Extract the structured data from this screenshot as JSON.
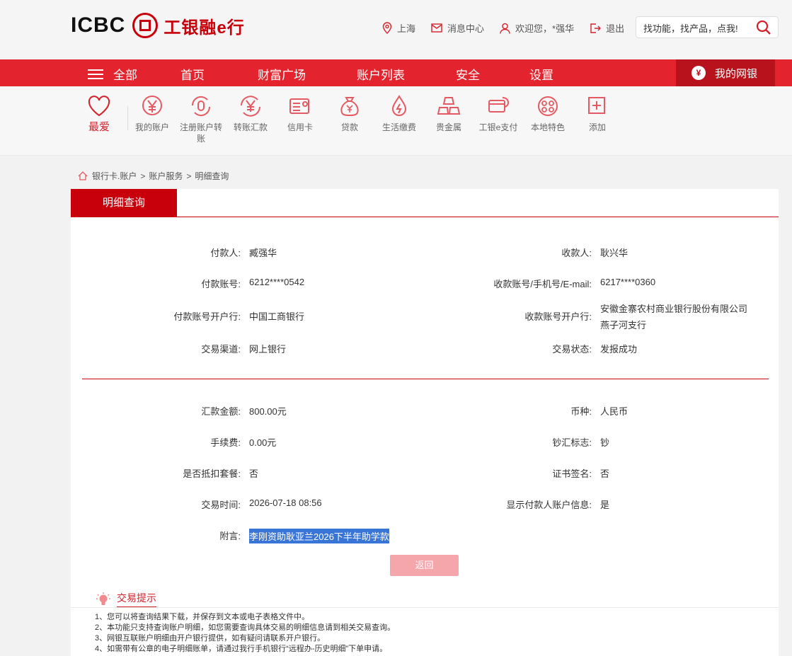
{
  "header": {
    "logo_en": "ICBC",
    "logo_cn": "工银融e行",
    "location": "上海",
    "messages": "消息中心",
    "welcome": "欢迎您，*强华",
    "logout": "退出",
    "search_placeholder": "找功能，找产品，点我!"
  },
  "nav": {
    "all": "全部",
    "items": [
      "首页",
      "财富广场",
      "账户列表",
      "安全",
      "设置"
    ],
    "mybank": "我的网银"
  },
  "quick": {
    "favorite": "最爱",
    "items": [
      {
        "label": "我的账户",
        "icon": "yen-coin-icon"
      },
      {
        "label": "注册账户转账",
        "icon": "account-transfer-icon"
      },
      {
        "label": "转账汇款",
        "icon": "transfer-icon"
      },
      {
        "label": "信用卡",
        "icon": "credit-card-icon"
      },
      {
        "label": "贷款",
        "icon": "loan-bag-icon"
      },
      {
        "label": "生活缴费",
        "icon": "utility-icon"
      },
      {
        "label": "贵金属",
        "icon": "gold-bars-icon"
      },
      {
        "label": "工银e支付",
        "icon": "e-pay-icon"
      },
      {
        "label": "本地特色",
        "icon": "local-features-icon"
      },
      {
        "label": "添加",
        "icon": "add-icon"
      }
    ]
  },
  "breadcrumb": [
    "银行卡.账户",
    "账户服务",
    "明细查询"
  ],
  "panel": {
    "tab": "明细查询",
    "fields": {
      "payer_label": "付款人:",
      "payer": "臧强华",
      "payee_label": "收款人:",
      "payee": "耿兴华",
      "payer_acct_label": "付款账号:",
      "payer_acct": "6212****0542",
      "payee_acct_label": "收款账号/手机号/E-mail:",
      "payee_acct": "6217****0360",
      "payer_bank_label": "付款账号开户行:",
      "payer_bank": "中国工商银行",
      "payee_bank_label": "收款账号开户行:",
      "payee_bank_line1": "安徽金寨农村商业银行股份有限公司",
      "payee_bank_line2": "燕子河支行",
      "channel_label": "交易渠道:",
      "channel": "网上银行",
      "status_label": "交易状态:",
      "status": "发报成功",
      "amount_label": "汇款金额:",
      "amount": "800.00元",
      "currency_label": "币种:",
      "currency": "人民币",
      "fee_label": "手续费:",
      "fee": "0.00元",
      "cash_label": "钞汇标志:",
      "cash": "钞",
      "package_label": "是否抵扣套餐:",
      "package": "否",
      "cert_label": "证书签名:",
      "cert": "否",
      "time_label": "交易时间:",
      "time": "2026-07-18 08:56",
      "show_payer_label": "显示付款人账户信息:",
      "show_payer": "是",
      "memo_label": "附言:",
      "memo": "李刚资助耿亚兰2026下半年助学款"
    },
    "back_button": "返回"
  },
  "tips": {
    "title": "交易提示",
    "items": [
      "1、您可以将查询结果下载，并保存到文本或电子表格文件中。",
      "2、本功能只支持查询账户明细，如您需要查询具体交易的明细信息请到相关交易查询。",
      "3、网银互联账户明细由开户银行提供，如有疑问请联系开户银行。",
      "4、如需带有公章的电子明细账单，请通过我行手机银行“远程办-历史明细”下单申请。"
    ]
  },
  "colors": {
    "brand_red": "#c7000b",
    "nav_red": "#e3232d",
    "memo_highlight": "#3875d7"
  }
}
